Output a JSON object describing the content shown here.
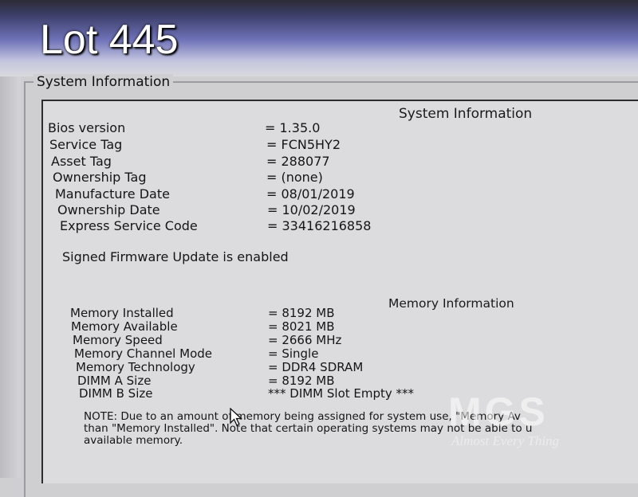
{
  "overlay": {
    "lot_label": "Lot 445"
  },
  "group_box": {
    "legend": "System Information"
  },
  "system_info": {
    "heading": "System Information",
    "rows": [
      {
        "label": "Bios version",
        "value": "= 1.35.0"
      },
      {
        "label": "Service Tag",
        "value": "= FCN5HY2"
      },
      {
        "label": "Asset Tag",
        "value": "= 288077"
      },
      {
        "label": "Ownership Tag",
        "value": "= (none)"
      },
      {
        "label": "Manufacture Date",
        "value": "= 08/01/2019"
      },
      {
        "label": "Ownership Date",
        "value": "= 10/02/2019"
      },
      {
        "label": "Express Service Code",
        "value": "= 33416216858"
      }
    ],
    "firmware_status": "Signed Firmware Update is enabled"
  },
  "memory_info": {
    "heading": "Memory Information",
    "rows": [
      {
        "label": "Memory Installed",
        "value": "= 8192 MB"
      },
      {
        "label": "Memory Available",
        "value": "= 8021 MB"
      },
      {
        "label": "Memory Speed",
        "value": "= 2666 MHz"
      },
      {
        "label": "Memory Channel Mode",
        "value": "= Single"
      },
      {
        "label": "Memory Technology",
        "value": "= DDR4 SDRAM"
      },
      {
        "label": "DIMM A Size",
        "value": "= 8192 MB"
      },
      {
        "label": "DIMM B Size",
        "value": "*** DIMM Slot Empty ***"
      }
    ],
    "note_lines": [
      "NOTE: Due to an amount of memory being assigned for system use, \"Memory Av",
      "than \"Memory Installed\". Note that certain operating systems may not be able to u",
      "available memory."
    ]
  },
  "watermark": {
    "text": "MGS",
    "subtext": "Almost Every Thing"
  }
}
